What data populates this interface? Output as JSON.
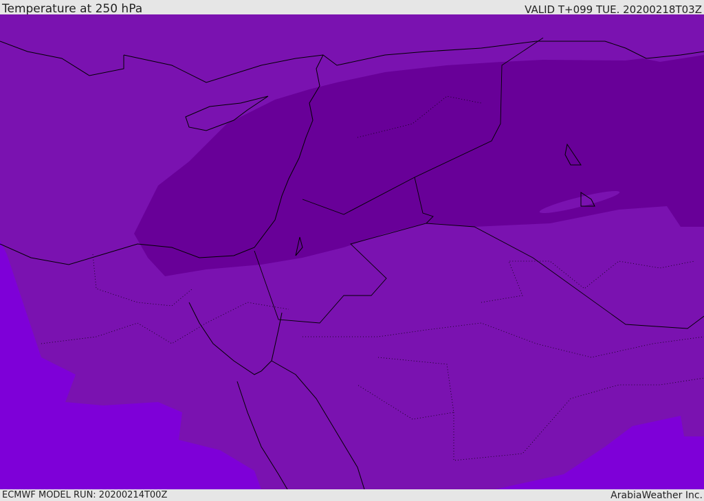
{
  "header": {
    "title": "Temperature at 250 hPa",
    "valid": "VALID T+099 TUE. 20200218T03Z"
  },
  "footer": {
    "model_run": "ECMWF MODEL RUN: 20200214T00Z",
    "brand": "ArabiaWeather Inc."
  },
  "colors": {
    "base": "#7a12b0",
    "cold": "#680098",
    "warm": "#7e00d8",
    "coast": "#000000"
  }
}
